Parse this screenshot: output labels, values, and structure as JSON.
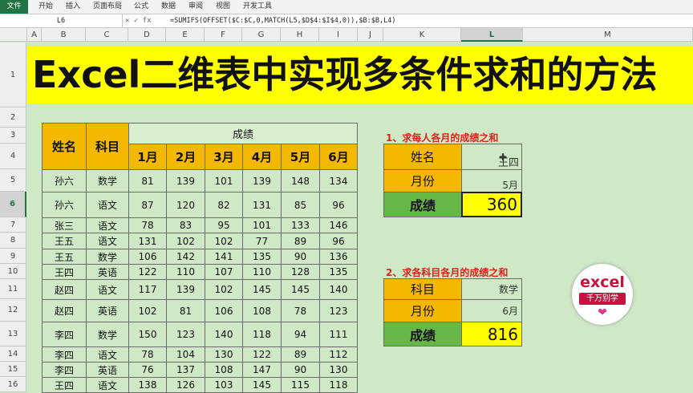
{
  "ribbon": {
    "file": "文件",
    "tabs": [
      "开始",
      "插入",
      "页面布局",
      "公式",
      "数据",
      "审阅",
      "视图",
      "开发工具"
    ]
  },
  "formula_bar": {
    "name_box": "L6",
    "icons": "✕ ✓ fx",
    "formula": "=SUMIFS(OFFSET($C:$C,0,MATCH(L5,$D$4:$I$4,0)),$B:$B,L4)"
  },
  "columns": [
    "A",
    "B",
    "C",
    "D",
    "E",
    "F",
    "G",
    "H",
    "I",
    "J",
    "K",
    "L",
    "M"
  ],
  "selected_column": "L",
  "rows": [
    "1",
    "2",
    "3",
    "4",
    "5",
    "6",
    "7",
    "8",
    "9",
    "10",
    "11",
    "12",
    "13",
    "14",
    "15",
    "16"
  ],
  "selected_row": "6",
  "title": "Excel二维表中实现多条件求和的方法",
  "table": {
    "h_name": "姓名",
    "h_subject": "科目",
    "h_score": "成绩",
    "months": [
      "1月",
      "2月",
      "3月",
      "4月",
      "5月",
      "6月"
    ],
    "rows": [
      {
        "name": "孙六",
        "subject": "数学",
        "values": [
          "81",
          "139",
          "101",
          "139",
          "148",
          "134"
        ]
      },
      {
        "name": "孙六",
        "subject": "语文",
        "values": [
          "87",
          "120",
          "82",
          "131",
          "85",
          "96"
        ]
      },
      {
        "name": "张三",
        "subject": "语文",
        "values": [
          "78",
          "83",
          "95",
          "101",
          "133",
          "146"
        ]
      },
      {
        "name": "王五",
        "subject": "语文",
        "values": [
          "131",
          "102",
          "102",
          "77",
          "89",
          "96"
        ]
      },
      {
        "name": "王五",
        "subject": "数学",
        "values": [
          "106",
          "142",
          "141",
          "135",
          "90",
          "136"
        ]
      },
      {
        "name": "王四",
        "subject": "英语",
        "values": [
          "122",
          "110",
          "107",
          "110",
          "128",
          "135"
        ]
      },
      {
        "name": "赵四",
        "subject": "语文",
        "values": [
          "117",
          "139",
          "102",
          "145",
          "145",
          "140"
        ]
      },
      {
        "name": "赵四",
        "subject": "英语",
        "values": [
          "102",
          "81",
          "106",
          "108",
          "78",
          "123"
        ]
      },
      {
        "name": "李四",
        "subject": "数学",
        "values": [
          "150",
          "123",
          "140",
          "118",
          "94",
          "111"
        ]
      },
      {
        "name": "李四",
        "subject": "语文",
        "values": [
          "78",
          "104",
          "130",
          "122",
          "89",
          "112"
        ]
      },
      {
        "name": "李四",
        "subject": "英语",
        "values": [
          "76",
          "137",
          "108",
          "147",
          "90",
          "130"
        ]
      },
      {
        "name": "王四",
        "subject": "语文",
        "values": [
          "138",
          "126",
          "103",
          "145",
          "115",
          "118"
        ]
      }
    ]
  },
  "q1": {
    "title": "1、求每人各月的成绩之和",
    "name_label": "姓名",
    "name_value": "王四",
    "month_label": "月份",
    "month_value": "5月",
    "score_label": "成绩",
    "score_value": "360"
  },
  "q2": {
    "title": "2、求各科目各月的成绩之和",
    "subject_label": "科目",
    "subject_value": "数学",
    "month_label": "月份",
    "month_value": "6月",
    "score_label": "成绩",
    "score_value": "816"
  },
  "logo": {
    "line1": "excel",
    "line2": "千万别学",
    "heart": "❤"
  },
  "cursor": "✚",
  "colors": {
    "excel_green": "#217346",
    "title_yellow": "#ffff00",
    "header_orange": "#f5b800",
    "total_green": "#67b64a",
    "question_red": "#e0201a",
    "sheet_bg": "#cfe9c6"
  }
}
